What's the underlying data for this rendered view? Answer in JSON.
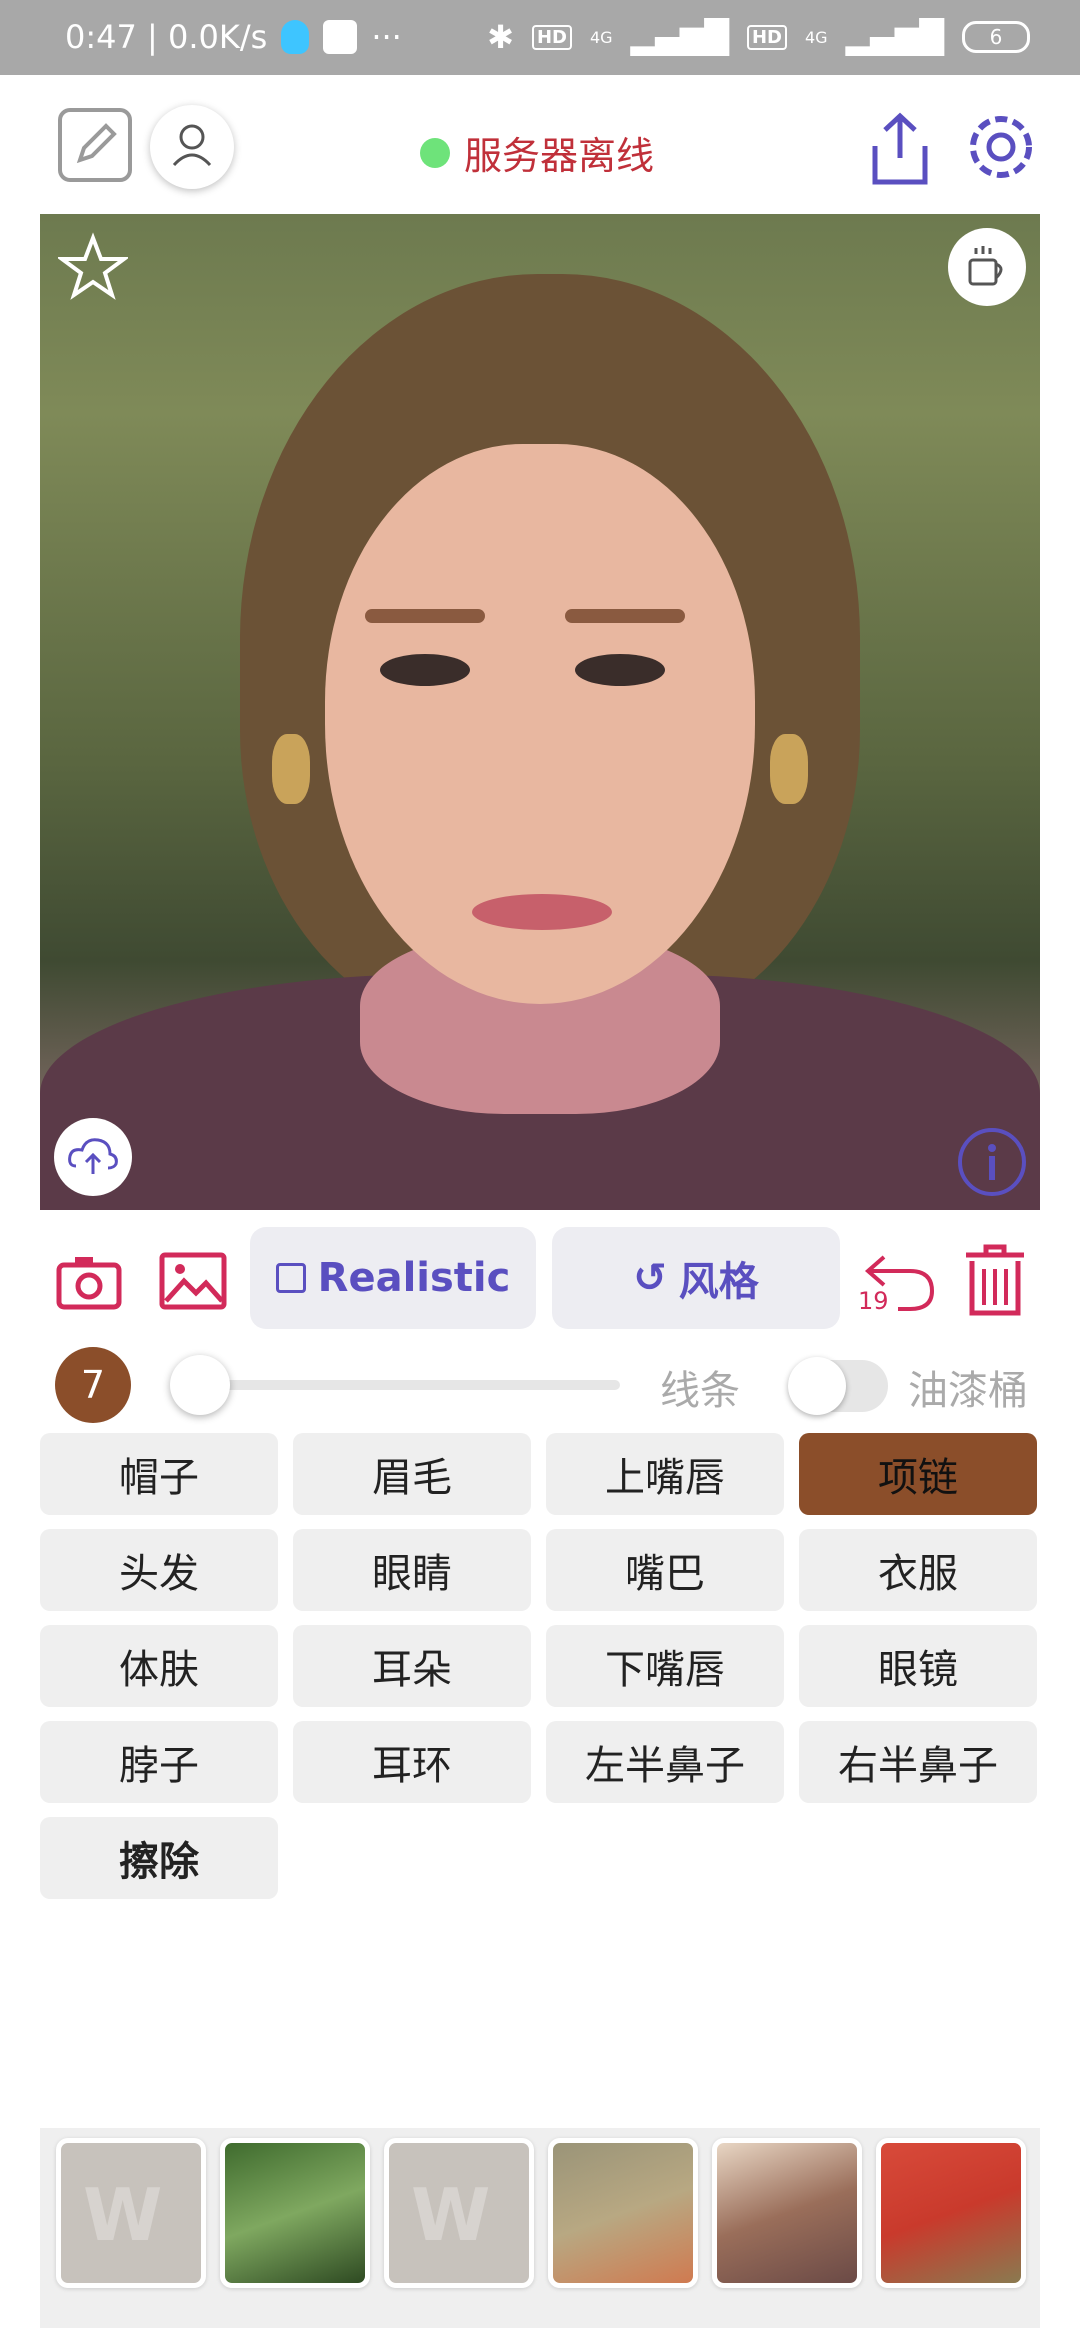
{
  "status_bar": {
    "time_speed": "0:47 | 0.0K/s",
    "more": "···",
    "hd1": "HD",
    "net1": "4G",
    "hd2": "HD",
    "net2": "4G",
    "battery": "6"
  },
  "header": {
    "server_status": "服务器离线",
    "server_status_color": "#c0303a",
    "status_dot_color": "#6ee37a"
  },
  "toolbar": {
    "realistic_label": "Realistic",
    "style_label": "风格",
    "undo_count": "19",
    "accent_color": "#5a4fc0",
    "icon_color": "#d22a5a"
  },
  "brush": {
    "size": "7",
    "lines_label": "线条",
    "bucket_label": "油漆桶",
    "bucket_enabled": false
  },
  "parts": [
    {
      "label": "帽子"
    },
    {
      "label": "眉毛"
    },
    {
      "label": "上嘴唇"
    },
    {
      "label": "项链"
    },
    {
      "label": "头发"
    },
    {
      "label": "眼睛"
    },
    {
      "label": "嘴巴"
    },
    {
      "label": "衣服"
    },
    {
      "label": "体肤"
    },
    {
      "label": "耳朵"
    },
    {
      "label": "下嘴唇"
    },
    {
      "label": "眼镜"
    },
    {
      "label": "脖子"
    },
    {
      "label": "耳环"
    },
    {
      "label": "左半鼻子"
    },
    {
      "label": "右半鼻子"
    },
    {
      "label": "擦除"
    }
  ],
  "selected_part": "项链",
  "selected_color": "#8b4e2a",
  "thumbnails": [
    "placeholder",
    "forest",
    "placeholder",
    "autumn-field",
    "bread",
    "red-tree"
  ]
}
